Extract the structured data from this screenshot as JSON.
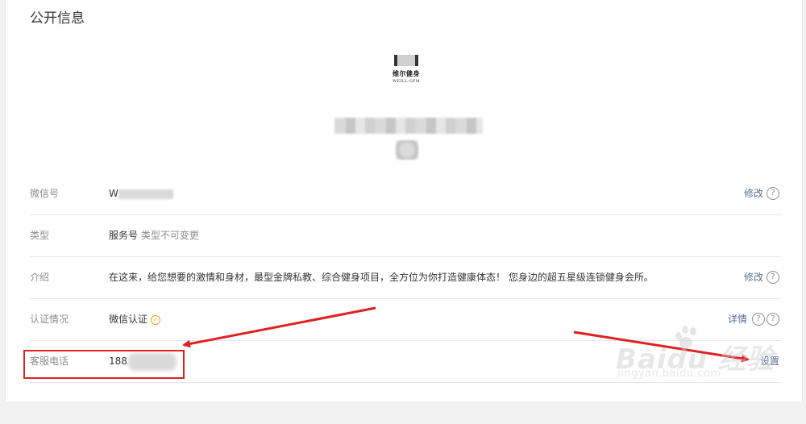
{
  "section": {
    "title": "公开信息"
  },
  "account_logo": {
    "name": "维尔健身",
    "subtitle": "WEILL-GYM"
  },
  "rows": [
    {
      "label": "微信号",
      "value": "W",
      "value_note": "",
      "action": "修改"
    },
    {
      "label": "类型",
      "value": "服务号",
      "value_note": "类型不可变更",
      "action": ""
    },
    {
      "label": "介绍",
      "value": "在这来，给您想要的激情和身材，最型金牌私教、综合健身项目，全方位为你打造健康体态！ 您身边的超五星级连锁健身会所。",
      "value_note": "",
      "action": "修改"
    },
    {
      "label": "认证情况",
      "value": "微信认证",
      "value_note": "",
      "action": "详情"
    },
    {
      "label": "客服电话",
      "value": "188",
      "value_note": "",
      "action": "设置"
    }
  ],
  "icons": {
    "help": "?",
    "verified": "✓"
  },
  "annotation": {
    "highlight_color": "#e02020",
    "arrow_color": "#e02020"
  },
  "watermark": {
    "text": "Baidu 经验",
    "url": "jingyan.baidu.com"
  }
}
